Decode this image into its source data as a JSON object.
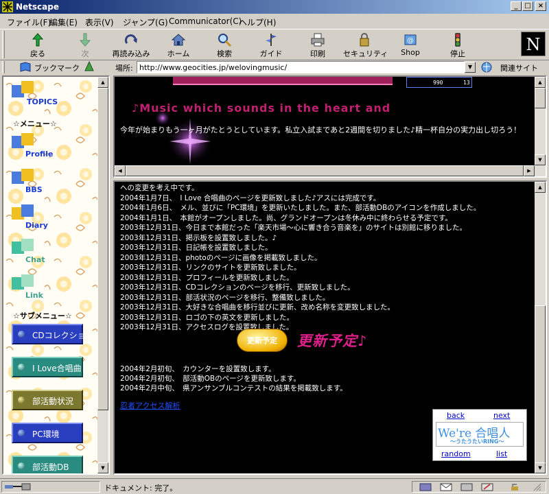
{
  "window": {
    "title": "Netscape"
  },
  "menu": [
    "ファイル(F)",
    "編集(E)",
    "表示(V)",
    "ジャンプ(G)",
    "Communicator(C)",
    "ヘルプ(H)"
  ],
  "toolbar": [
    {
      "label": "戻る",
      "icon": "back-arrow-icon"
    },
    {
      "label": "次",
      "icon": "forward-arrow-icon"
    },
    {
      "label": "再読み込み",
      "icon": "reload-icon"
    },
    {
      "label": "ホーム",
      "icon": "home-icon"
    },
    {
      "label": "検索",
      "icon": "search-icon"
    },
    {
      "label": "ガイド",
      "icon": "guide-icon"
    },
    {
      "label": "印刷",
      "icon": "print-icon"
    },
    {
      "label": "セキュリティ",
      "icon": "security-icon"
    },
    {
      "label": "Shop",
      "icon": "shop-icon"
    },
    {
      "label": "停止",
      "icon": "stop-icon"
    }
  ],
  "brand_logo": "N",
  "location": {
    "bookmark_label": "ブックマーク",
    "location_label": "場所:",
    "url": "http://www.geocities.jp/welovingmusic/",
    "related_label": "関連サイト"
  },
  "left_nav": {
    "topics": "TOPICS",
    "menu_heading": "☆メニュー☆",
    "items": [
      "Profile",
      "BBS",
      "Diary",
      "Chat",
      "Link"
    ],
    "submenu_heading": "☆サブメニュー☆",
    "subitems": [
      "CDコレクション",
      "I Love合唱曲",
      "部活動状況",
      "PC環境",
      "部活動DB"
    ]
  },
  "top_frame": {
    "counter_left": "990",
    "counter_right": "13",
    "music_line": "♪Music which sounds in  the heart and",
    "message": "今年が始まりもう一ヶ月がたとうとしています。私立入試まであと2週間を切りました♪精一杯自分の実力出し切ろう！"
  },
  "main_frame": {
    "log": [
      "への変更を考え中です。",
      "2004年1月7日、　I Love 合唱曲のページを更新致しました♪アスには完成です。",
      "2004年1月6日、　メル、並びに「PC環境」を更新いたしました。また、部活動DBのアイコンを作成しました。",
      "2004年1月1日、　本館がオープンしました。尚、グランドオープンは冬休み中に終わらせる予定です。",
      "2003年12月31日、今日まで本館だった「楽天市場～心に響き合う音楽を」のサイトは別館に移りました。",
      "2003年12月31日、掲示板を設置致しました。♪",
      "2003年12月31日、日記帳を設置致しました。",
      "2003年12月31日、photoのページに画像を掲載致しました。",
      "2003年12月31日、リンクのサイトを更新致しました。",
      "2003年12月31日、プロフィールを更新致しました。",
      "2003年12月31日、CDコレクションのページを移行、更新致しました。",
      "2003年12月31日、部活状況のページを移行、整備致しました。",
      "2003年12月31日、大好きな合唱曲を移行並びに更新、改め名称を変更致しました。",
      "2003年12月31日、ロゴの下の英文を更新しました。",
      "2003年12月31日、アクセスログを設置致しました。"
    ],
    "plan_button": "更新予定",
    "plan_title": "更新予定♪",
    "plan": [
      "2004年2月初旬、　カウンターを設置致します。",
      "2004年2月初旬、　部活動OBのページを更新致します。",
      "2004年2月中旬、　県アンサンブルコンテストの結果を掲載致します。"
    ],
    "access_link": "忍者アクセス解析",
    "ring": {
      "back": "back",
      "next": "next",
      "logo_big": "We're 合唱人",
      "logo_small": "～うたうたいRING～",
      "random": "random",
      "list": "list"
    }
  },
  "status": {
    "text": "ドキュメント: 完了。"
  },
  "colors": {
    "accent_pink": "#e0208a",
    "link_blue": "#2050ff",
    "nav_blue": "#1a3ad4"
  }
}
